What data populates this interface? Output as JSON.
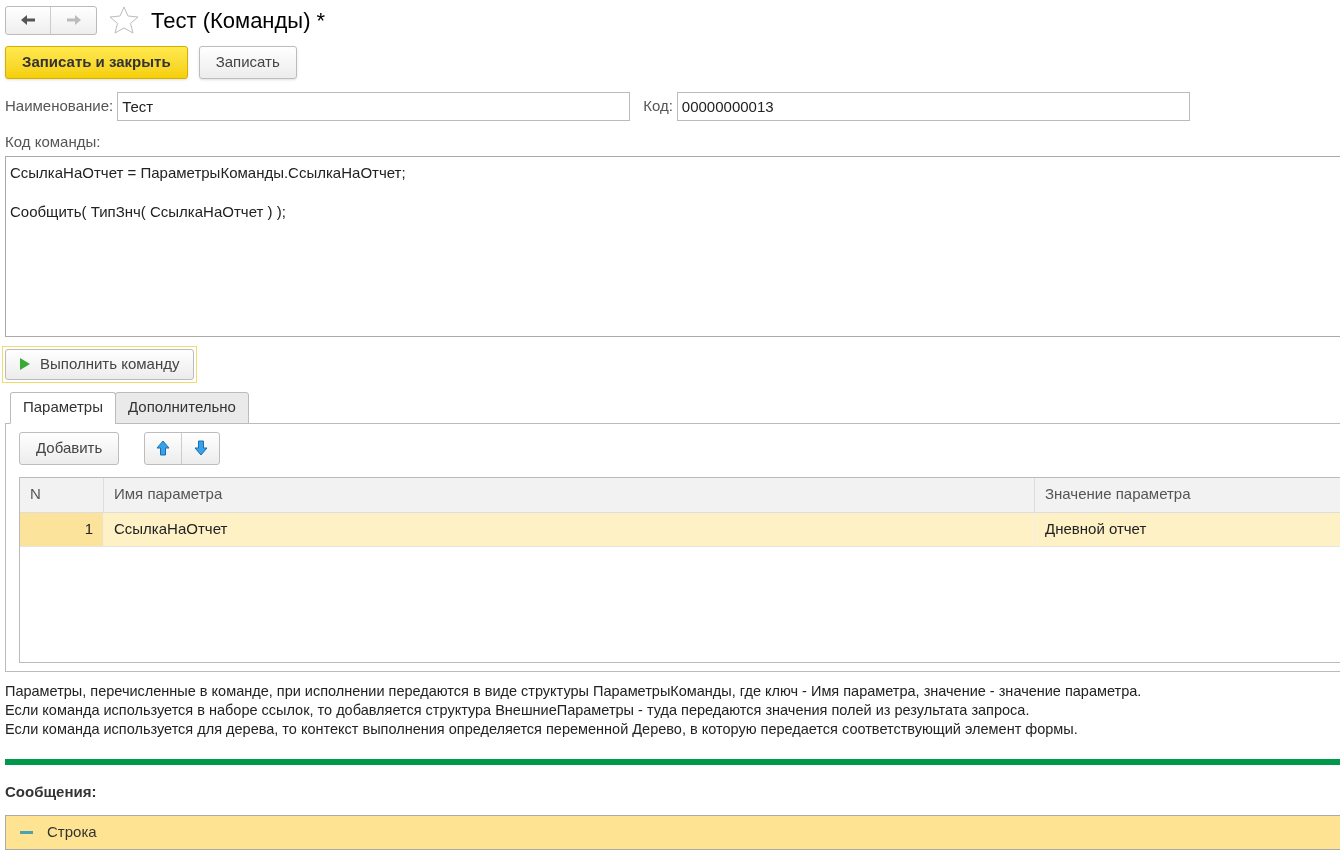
{
  "nav": {
    "back_disabled": false,
    "forward_disabled": true
  },
  "title": "Тест (Команды) *",
  "favorite": false,
  "buttons": [
    {
      "label": "Записать и закрыть",
      "kind": "primary"
    },
    {
      "label": "Записать",
      "kind": "default"
    }
  ],
  "fields": [
    {
      "label": "Наименование:",
      "value": "Тест"
    },
    {
      "label": "Код:",
      "value": "00000000013"
    }
  ],
  "code": {
    "label": "Код команды:",
    "paragraphs": [
      "СсылкаНаОтчет = ПараметрыКоманды.СсылкаНаОтчет;",
      "Сообщить( ТипЗнч( СсылкаНаОтчет ) );"
    ]
  },
  "execute_button": {
    "label": "Выполнить команду"
  },
  "tabs": [
    {
      "label": "Параметры",
      "selected": true
    },
    {
      "label": "Дополнительно",
      "selected": false
    }
  ],
  "add_button": {
    "label": "Добавить"
  },
  "table": {
    "columns": [
      "N",
      "Имя параметра",
      "Значение параметра"
    ],
    "rows": [
      {
        "cells": [
          "1",
          "СсылкаНаОтчет",
          "Дневной отчет"
        ],
        "selected": true
      }
    ]
  },
  "description": [
    "Параметры, перечисленные в команде, при исполнении передаются в виде структуры ПараметрыКоманды, где ключ - Имя параметра, значение - значение параметра.",
    "Если команда используется в наборе ссылок, то добавляется структура ВнешниеПараметры - туда передаются значения полей из результата запроса.",
    "Если команда используется для дерева, то контекст выполнения определяется переменной Дерево, в которую передается соответствующий элемент формы."
  ],
  "messages": {
    "title": "Сообщения:",
    "items": [
      {
        "text": "Строка",
        "expanded": true
      }
    ]
  }
}
